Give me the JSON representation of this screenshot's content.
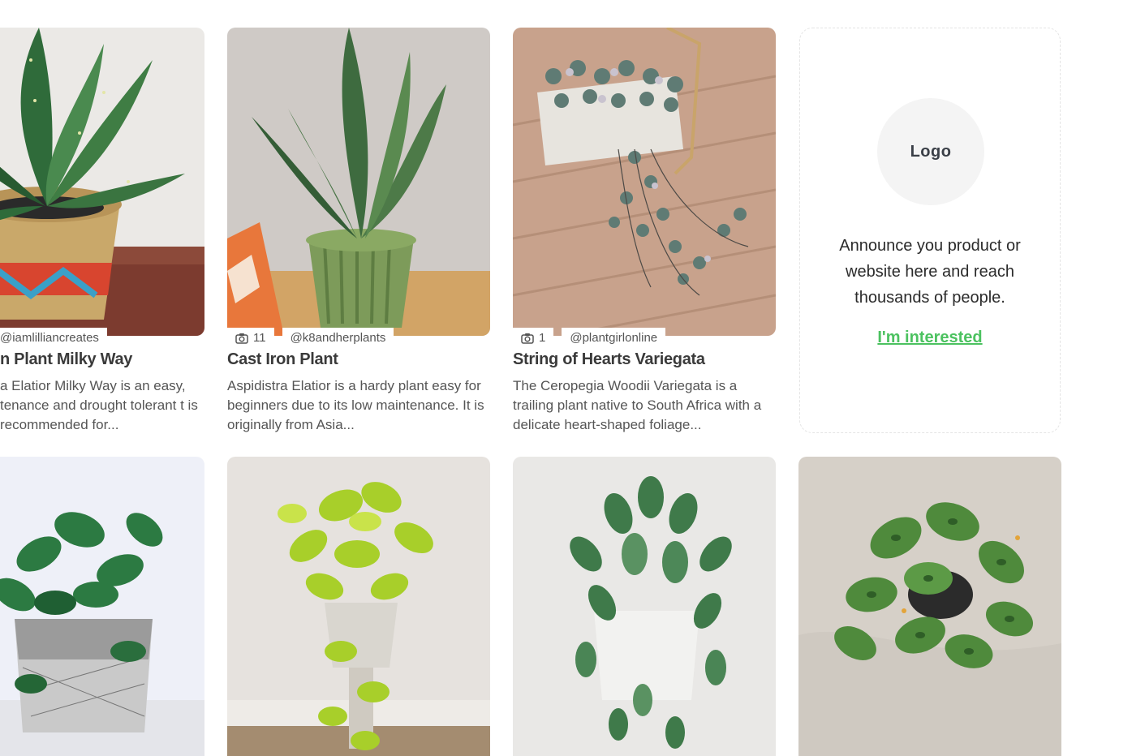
{
  "cards": [
    {
      "handle": "@iamlilliancreates",
      "photo_count": "",
      "title": "n Plant Milky Way",
      "description": "a Elatior Milky Way is an easy, tenance and drought tolerant t is recommended for..."
    },
    {
      "handle": "@k8andherplants",
      "photo_count": "11",
      "title": "Cast Iron Plant",
      "description": "Aspidistra Elatior is a hardy plant easy for beginners due to its low maintenance. It is originally from Asia..."
    },
    {
      "handle": "@plantgirlonline",
      "photo_count": "1",
      "title": "String of Hearts Variegata",
      "description": "The Ceropegia Woodii Variegata is a trailing plant native to South Africa with a delicate heart-shaped foliage..."
    }
  ],
  "ad": {
    "logo_label": "Logo",
    "text": "Announce you product or website here and reach thousands of people.",
    "link_label": "I'm interested"
  },
  "icons": {
    "photo_count": "camera-icon"
  },
  "colors": {
    "accent_green": "#4cc260"
  }
}
